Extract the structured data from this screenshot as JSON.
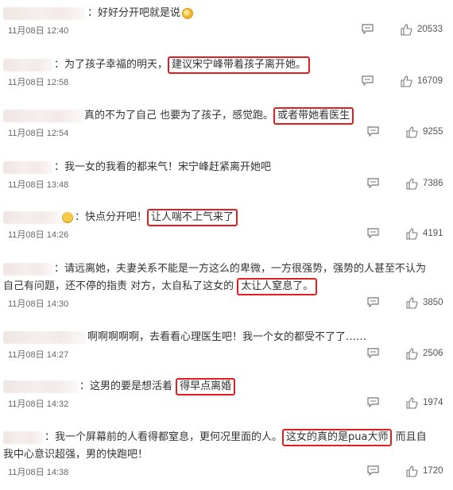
{
  "comments": [
    {
      "text_before": "：好好分开吧就是说",
      "highlight": "",
      "text_after": "",
      "time": "11月08日 12:40",
      "likes": "20533"
    },
    {
      "text_before": "：为了孩子幸福的明天，",
      "highlight": "建议宋宁峰带着孩子离开她。",
      "text_after": "",
      "time": "11月08日 12:58",
      "likes": "16709"
    },
    {
      "text_before": "真的不为了自己 也要为了孩子，感觉跑。",
      "highlight": "或者带她看医生",
      "text_after": "",
      "time": "11月08日 12:54",
      "likes": "9255"
    },
    {
      "text_before": "：我一女的我看的都来气！宋宁峰赶紧离开她吧",
      "highlight": "",
      "text_after": "",
      "time": "11月08日 13:48",
      "likes": "7386"
    },
    {
      "text_before": "：快点分开吧！",
      "highlight": "让人喘不上气来了",
      "text_after": "",
      "time": "11月08日 14:26",
      "likes": "4191"
    },
    {
      "text_before": "：请远离她，夫妻关系不能是一方这么的卑微，一方很强势，强势的人甚至不认为自己有问题，还不停的指责 对方，太自私了这女的",
      "highlight": "太让人窒息了。",
      "text_after": "",
      "time": "11月08日 14:30",
      "likes": "3850"
    },
    {
      "text_before": "啊啊啊啊啊，去看看心理医生吧！我一个女的都受不了了……",
      "highlight": "",
      "text_after": "",
      "time": "11月08日 14:27",
      "likes": "2506"
    },
    {
      "text_before": "：这男的要是想活着",
      "highlight": "得早点离婚",
      "text_after": "",
      "time": "11月08日 14:32",
      "likes": "1974"
    },
    {
      "text_before": "：我一个屏幕前的人看得都窒息，更何况里面的人。",
      "highlight": "这女的真的是pua大师",
      "text_after": "而且自我中心意识超强，男的快跑吧！",
      "time": "11月08日 14:38",
      "likes": "1720"
    }
  ]
}
